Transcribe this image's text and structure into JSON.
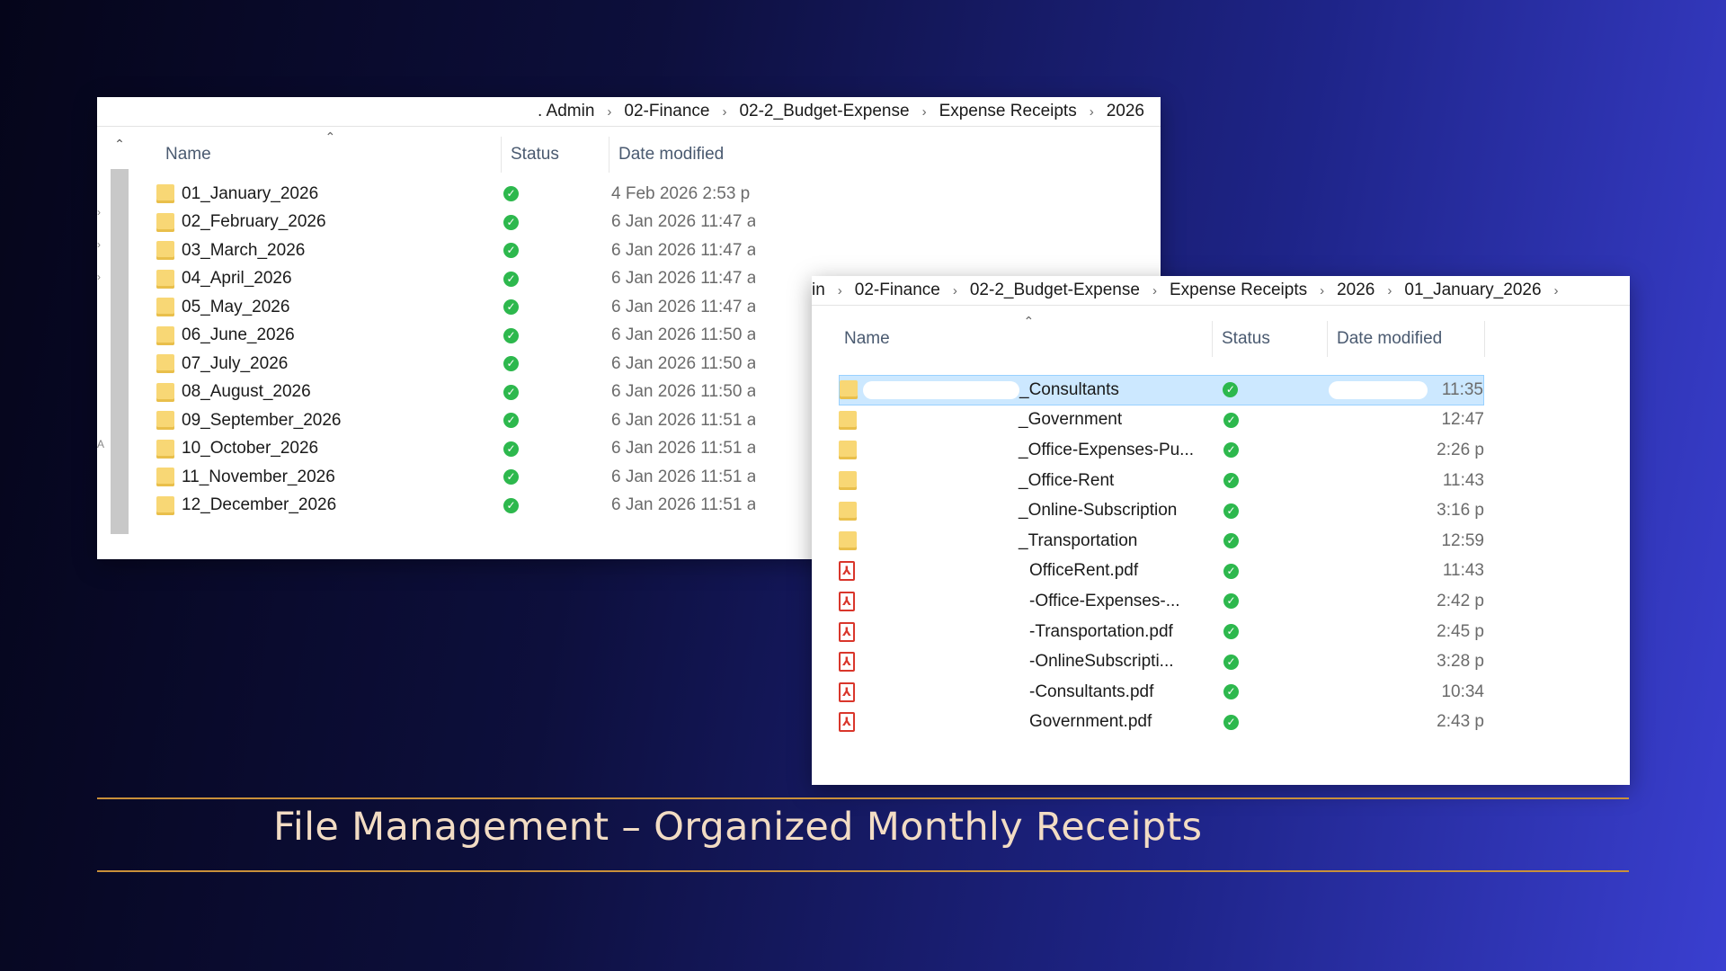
{
  "window1": {
    "breadcrumb": [
      ". Admin",
      "02-Finance",
      "02-2_Budget-Expense",
      "Expense Receipts",
      "2026"
    ],
    "columns": {
      "name": "Name",
      "status": "Status",
      "date": "Date modified"
    },
    "rows": [
      {
        "name": "01_January_2026",
        "date": "4 Feb 2026 2:53 p",
        "type": "folder"
      },
      {
        "name": "02_February_2026",
        "date": "6 Jan 2026 11:47 a",
        "type": "folder"
      },
      {
        "name": "03_March_2026",
        "date": "6 Jan 2026 11:47 a",
        "type": "folder"
      },
      {
        "name": "04_April_2026",
        "date": "6 Jan 2026 11:47 a",
        "type": "folder"
      },
      {
        "name": "05_May_2026",
        "date": "6 Jan 2026 11:47 a",
        "type": "folder"
      },
      {
        "name": "06_June_2026",
        "date": "6 Jan 2026 11:50 a",
        "type": "folder"
      },
      {
        "name": "07_July_2026",
        "date": "6 Jan 2026 11:50 a",
        "type": "folder"
      },
      {
        "name": "08_August_2026",
        "date": "6 Jan 2026 11:50 a",
        "type": "folder"
      },
      {
        "name": "09_September_2026",
        "date": "6 Jan 2026 11:51 a",
        "type": "folder"
      },
      {
        "name": "10_October_2026",
        "date": "6 Jan 2026 11:51 a",
        "type": "folder"
      },
      {
        "name": "11_November_2026",
        "date": "6 Jan 2026 11:51 a",
        "type": "folder"
      },
      {
        "name": "12_December_2026",
        "date": "6 Jan 2026 11:51 a",
        "type": "folder"
      }
    ],
    "edge_label": "A"
  },
  "window2": {
    "breadcrumb": [
      "in",
      "02-Finance",
      "02-2_Budget-Expense",
      "Expense Receipts",
      "2026",
      "01_January_2026"
    ],
    "columns": {
      "name": "Name",
      "status": "Status",
      "date": "Date modified"
    },
    "rows": [
      {
        "name": "_Consultants",
        "date": "11:35",
        "type": "folder",
        "selected": true
      },
      {
        "name": "_Government",
        "date": "12:47",
        "type": "folder"
      },
      {
        "name": "_Office-Expenses-Pu...",
        "date": "2:26 p",
        "type": "folder"
      },
      {
        "name": "_Office-Rent",
        "date": "11:43",
        "type": "folder"
      },
      {
        "name": "_Online-Subscription",
        "date": "3:16 p",
        "type": "folder"
      },
      {
        "name": "_Transportation",
        "date": "12:59",
        "type": "folder"
      },
      {
        "name": "OfficeRent.pdf",
        "date": "11:43",
        "type": "pdf"
      },
      {
        "name": "-Office-Expenses-...",
        "date": "2:42 p",
        "type": "pdf"
      },
      {
        "name": "-Transportation.pdf",
        "date": "2:45 p",
        "type": "pdf"
      },
      {
        "name": "-OnlineSubscripti...",
        "date": "3:28 p",
        "type": "pdf"
      },
      {
        "name": "-Consultants.pdf",
        "date": "10:34",
        "type": "pdf"
      },
      {
        "name": "Government.pdf",
        "date": "2:43 p",
        "type": "pdf"
      }
    ]
  },
  "caption": "File Management – Organized Monthly Receipts",
  "colors": {
    "accent_rule": "#c9903a",
    "caption_text": "#f2dcc4",
    "sync_green": "#2db84d",
    "folder_yellow": "#f8d775",
    "pdf_red": "#d9362b",
    "selection": "#cce8ff"
  },
  "icons": {
    "folder": "folder-icon",
    "pdf": "pdf-file-icon",
    "status": "sync-ok-icon",
    "breadcrumb_separator": "chevron-right-icon",
    "sort": "chevron-up-icon",
    "scroll_up": "scroll-up-arrow-icon"
  }
}
